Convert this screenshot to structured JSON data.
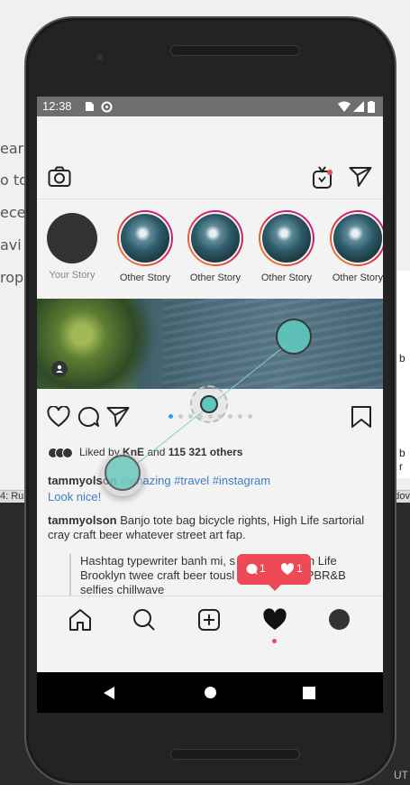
{
  "ide": {
    "left_fragments": [
      "earc",
      "o to",
      "ece",
      "avi",
      "rop"
    ],
    "status_left": "4: Ru",
    "status_right": "dov",
    "right_b": "b",
    "right_r": "r",
    "corner": "UT"
  },
  "status_bar": {
    "time": "12:38"
  },
  "stories": [
    {
      "label": "Your Story",
      "own": true
    },
    {
      "label": "Other Story",
      "own": false
    },
    {
      "label": "Other Story",
      "own": false
    },
    {
      "label": "Other Story",
      "own": false
    },
    {
      "label": "Other Story",
      "own": false
    }
  ],
  "post": {
    "liked_by_prefix": "Liked by ",
    "liked_by_user": "KnE",
    "liked_by_middle": " and ",
    "liked_by_count": "115 321 others",
    "caption_user": "tammyolson",
    "caption_hashtags": " #amazing #travel #instagram",
    "caption_link": "Look nice!",
    "comment_user": "tammyolson",
    "comment_text": " Banjo tote bag bicycle rights, High Life sartorial cray craft beer whatever street art fap.",
    "reply_text": "Hashtag typewriter banh mi, s                 High Life Brooklyn twee craft beer tousl                      PBR&B selfies chillwave"
  },
  "notification": {
    "comments": "1",
    "likes": "1"
  },
  "colors": {
    "accent": "#ed4956",
    "hashtag": "#3d7fc4",
    "touch": "#5ec8bb"
  }
}
